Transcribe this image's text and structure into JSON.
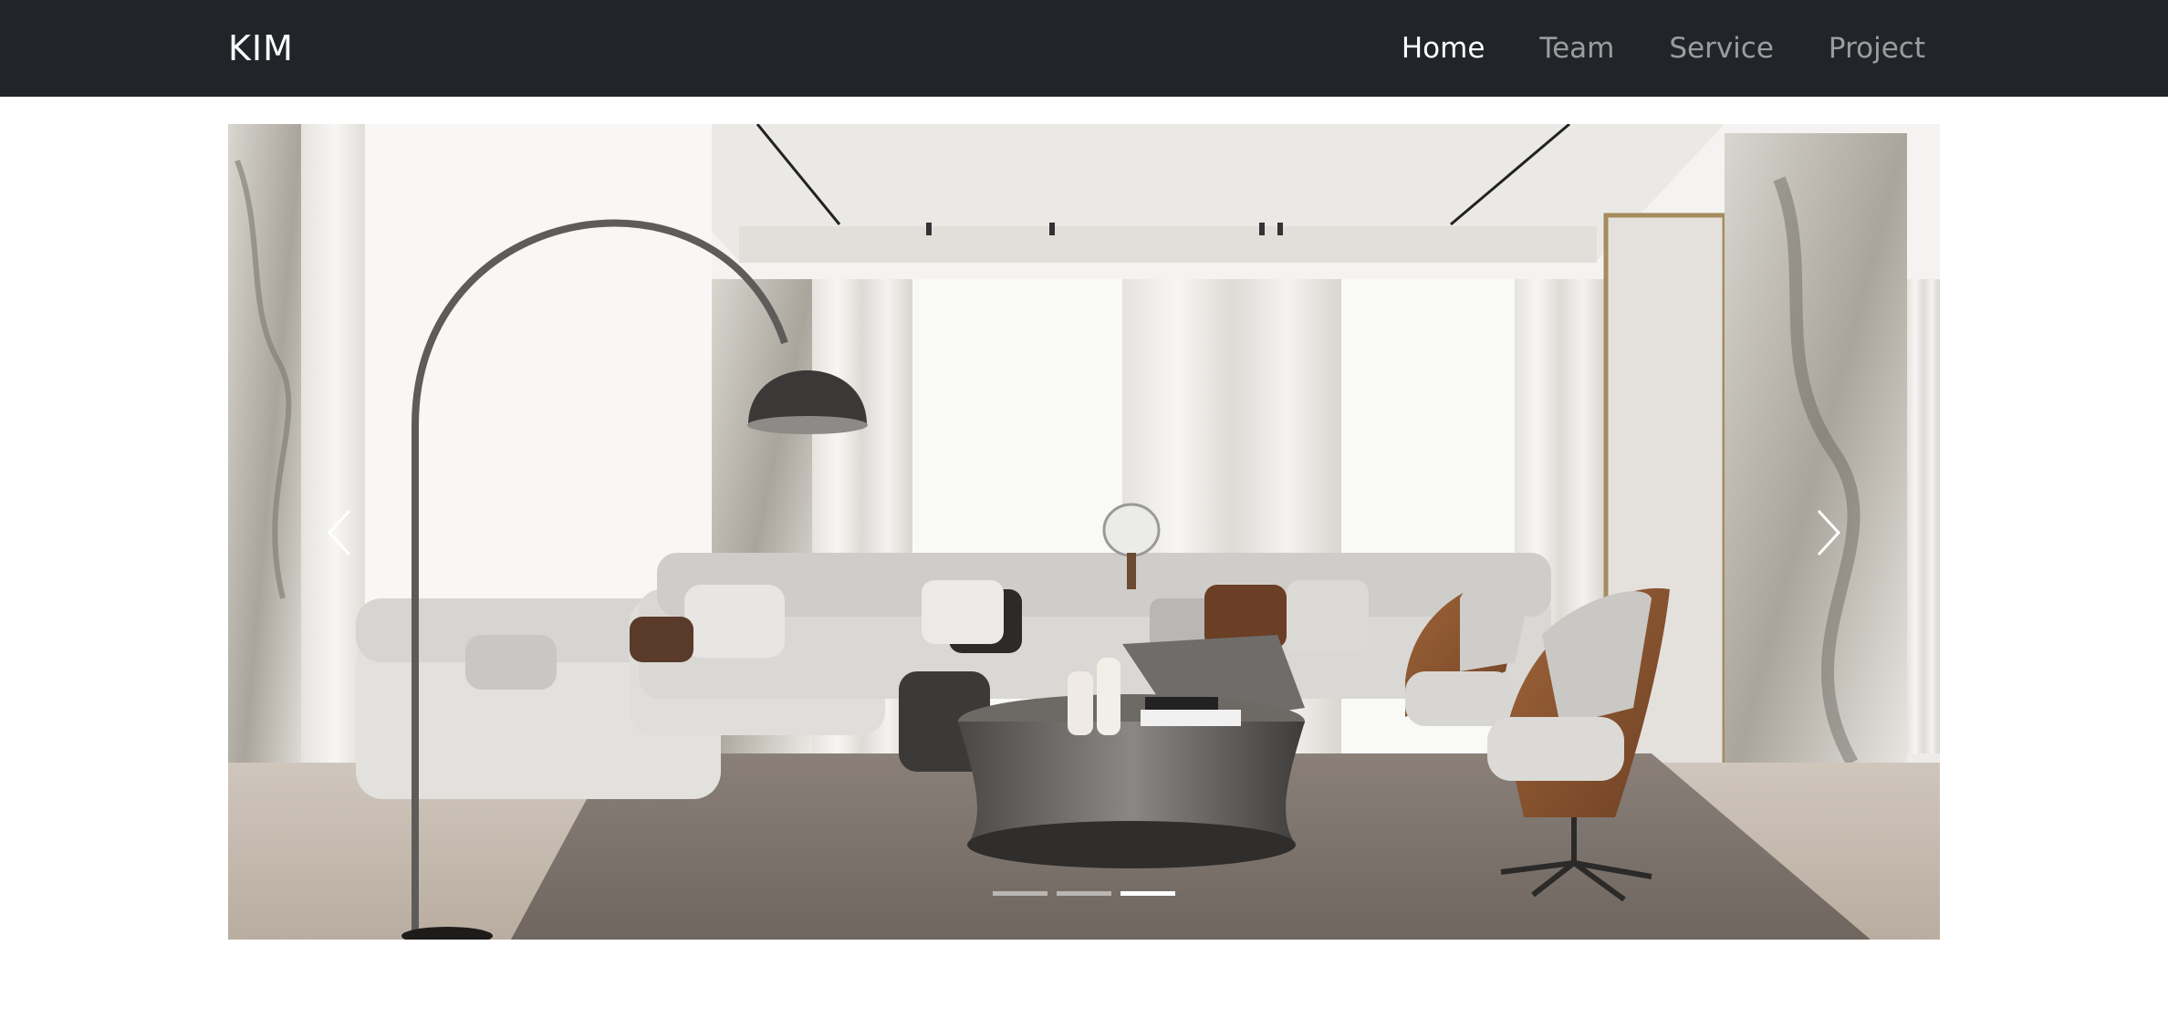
{
  "navbar": {
    "brand": "KIM",
    "links": [
      {
        "label": "Home",
        "active": true
      },
      {
        "label": "Team",
        "active": false
      },
      {
        "label": "Service",
        "active": false
      },
      {
        "label": "Project",
        "active": false
      }
    ]
  },
  "carousel": {
    "slide_count": 3,
    "active_index": 2,
    "prev_icon": "chevron-left-icon",
    "next_icon": "chevron-right-icon",
    "image_subject": "modern living room interior"
  },
  "colors": {
    "navbar_bg": "#212529",
    "nav_active": "#ffffff",
    "nav_inactive": "rgba(255,255,255,0.55)"
  }
}
